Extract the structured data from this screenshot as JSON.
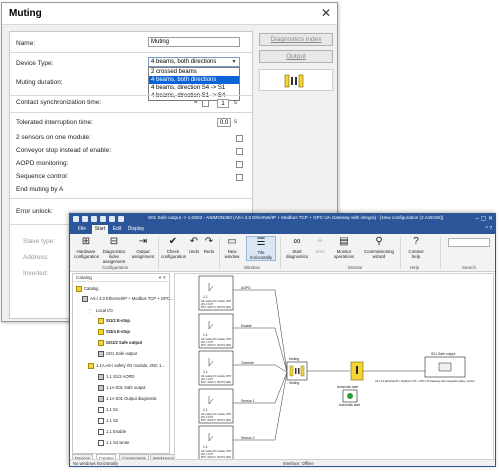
{
  "dialog": {
    "title": "Muting",
    "name_label": "Name:",
    "name_value": "Muting",
    "device_type_label": "Device Type:",
    "device_type_value": "4 beams, both directions",
    "device_type_options": [
      "2 crossed beams",
      "4 beams, both directions",
      "4 beams, direction S4 -> S1",
      "4 beams, direction S1 -> S4"
    ],
    "muting_duration_label": "Muting duration:",
    "contact_sync_label": "Contact synchronization time:",
    "contact_sync_value": "1",
    "contact_sync_unit": "s",
    "tolerated_interruption_label": "Tolerated interruption time:",
    "tolerated_interruption_value": "0.0",
    "tolerated_interruption_unit": "s",
    "two_sensors_label": "2 sensors on one module:",
    "conveyor_stop_label": "Conveyor stop instead of enable:",
    "aopd_label": "AOPD monitoring:",
    "sequence_label": "Sequence control:",
    "end_muting_label": "End muting by A",
    "error_unlock_label": "Error unlock:",
    "slave_type_label": "Slave type:",
    "address_label": "Address:",
    "inverted_label": "Inverted:",
    "diagnostics_index_button": "Diagnostics index",
    "output_button": "Output"
  },
  "window": {
    "title": "S01 Safe output -> 1.0S02 - ASIMON360 (AS-i 3.0 EtherNet/IP + Modbus TCP + OPC UA Gateway with integra) - [New configuration (2.ASIGW)]",
    "tabs": [
      "File",
      "Start",
      "Edit",
      "Display"
    ],
    "active_tab": "Start",
    "ribbon": {
      "hardware_config": "Hardware configuration",
      "diagnostics_assign": "Diagnostics index assignment",
      "output_assign": "Output assignment",
      "group_configuration": "Configuration",
      "check": "Check configuration",
      "undo": "Undo",
      "redo": "Redo",
      "new_window": "New window",
      "tile_horizontally": "Tile horizontally",
      "group_window": "Window",
      "start_diag": "Start diagnostics",
      "start": "Start",
      "monitor_ops": "Monitor operations",
      "commissioning": "Commissioning wizard",
      "group_monitor": "Monitor",
      "context_help": "Context help",
      "group_help": "Help",
      "group_search": "Search"
    }
  },
  "catalog": {
    "title": "Catalog",
    "root": "Catalog",
    "device": "AS-i 3.0 Ethernet/IP + Modbus TCP + OPC...",
    "local_io": "Local I/O",
    "items": [
      "SI1/2 E-stop",
      "SI3/4 E-stop",
      "SO1/2 Safe output",
      "SO1 Safe output"
    ],
    "module": "1.1A AS-i safety I/O module, 2NC 1...",
    "sub_items": [
      "1.1 S1/2 AOPD",
      "1.1A S01 Safe output",
      "1.1A S01 Output diagnostic",
      "1.1 S1",
      "1.1 S2",
      "1.1 Enable",
      "1.1 S4 wrote"
    ],
    "tabs": [
      "Devices",
      "Catalog",
      "Components",
      "Workspaces"
    ]
  },
  "diagram": {
    "blocks": [
      {
        "id": "1.1",
        "line2": "AS-i safety I/O module, IP67,",
        "line3": "2IN, 2 OUT",
        "line4": "IP67, 3OUT/2, 3OUT/2 (Mit)",
        "wire": "AOPD"
      },
      {
        "id": "1.1",
        "line2": "AS-i safety I/O module, IP67,",
        "line3": "2IN, 2 OUT",
        "line4": "IP67, 3OUT/2, 3OUT/2 (Mit)",
        "wire": "Enable"
      },
      {
        "id": "1.1",
        "line2": "AS-i safety I/O module, IP67,",
        "line3": "2IN, 2 OUT",
        "line4": "IP67, 3OUT/2, 3OUT/2 (Mit)",
        "wire": "Override"
      },
      {
        "id": "1.1",
        "line2": "AS-i safety I/O module, IP67,",
        "line3": "2IN, 2 OUT",
        "line4": "IP67, 3OUT/2, 3OUT/2 (Mit)",
        "wire": "Sensor 1"
      },
      {
        "id": "1.1",
        "line2": "AS-i safety I/O module, IP67,",
        "line3": "2IN, 2 OUT",
        "line4": "IP67, 3OUT/2, 3OUT/2 (Mit)",
        "wire": "Sensor 2"
      }
    ],
    "muting_block_label": "Muting",
    "muting_block_caption": "- Muting",
    "auto_start_label": "Automatic start",
    "auto_start_caption": "- Automatic start",
    "safe_output_label": "S01 Safe output",
    "safe_output_caption": "AS-i 3.0 EtherNet/IP + Modbus TCP + OPC UA Gateway with integrated safety monitor"
  },
  "status": {
    "left": "No windows horizontally",
    "center": "Interface: Offline"
  },
  "colors": {
    "accent": "#2b579a",
    "module_yellow": "#f5d43a",
    "selection": "#0a64d8"
  }
}
